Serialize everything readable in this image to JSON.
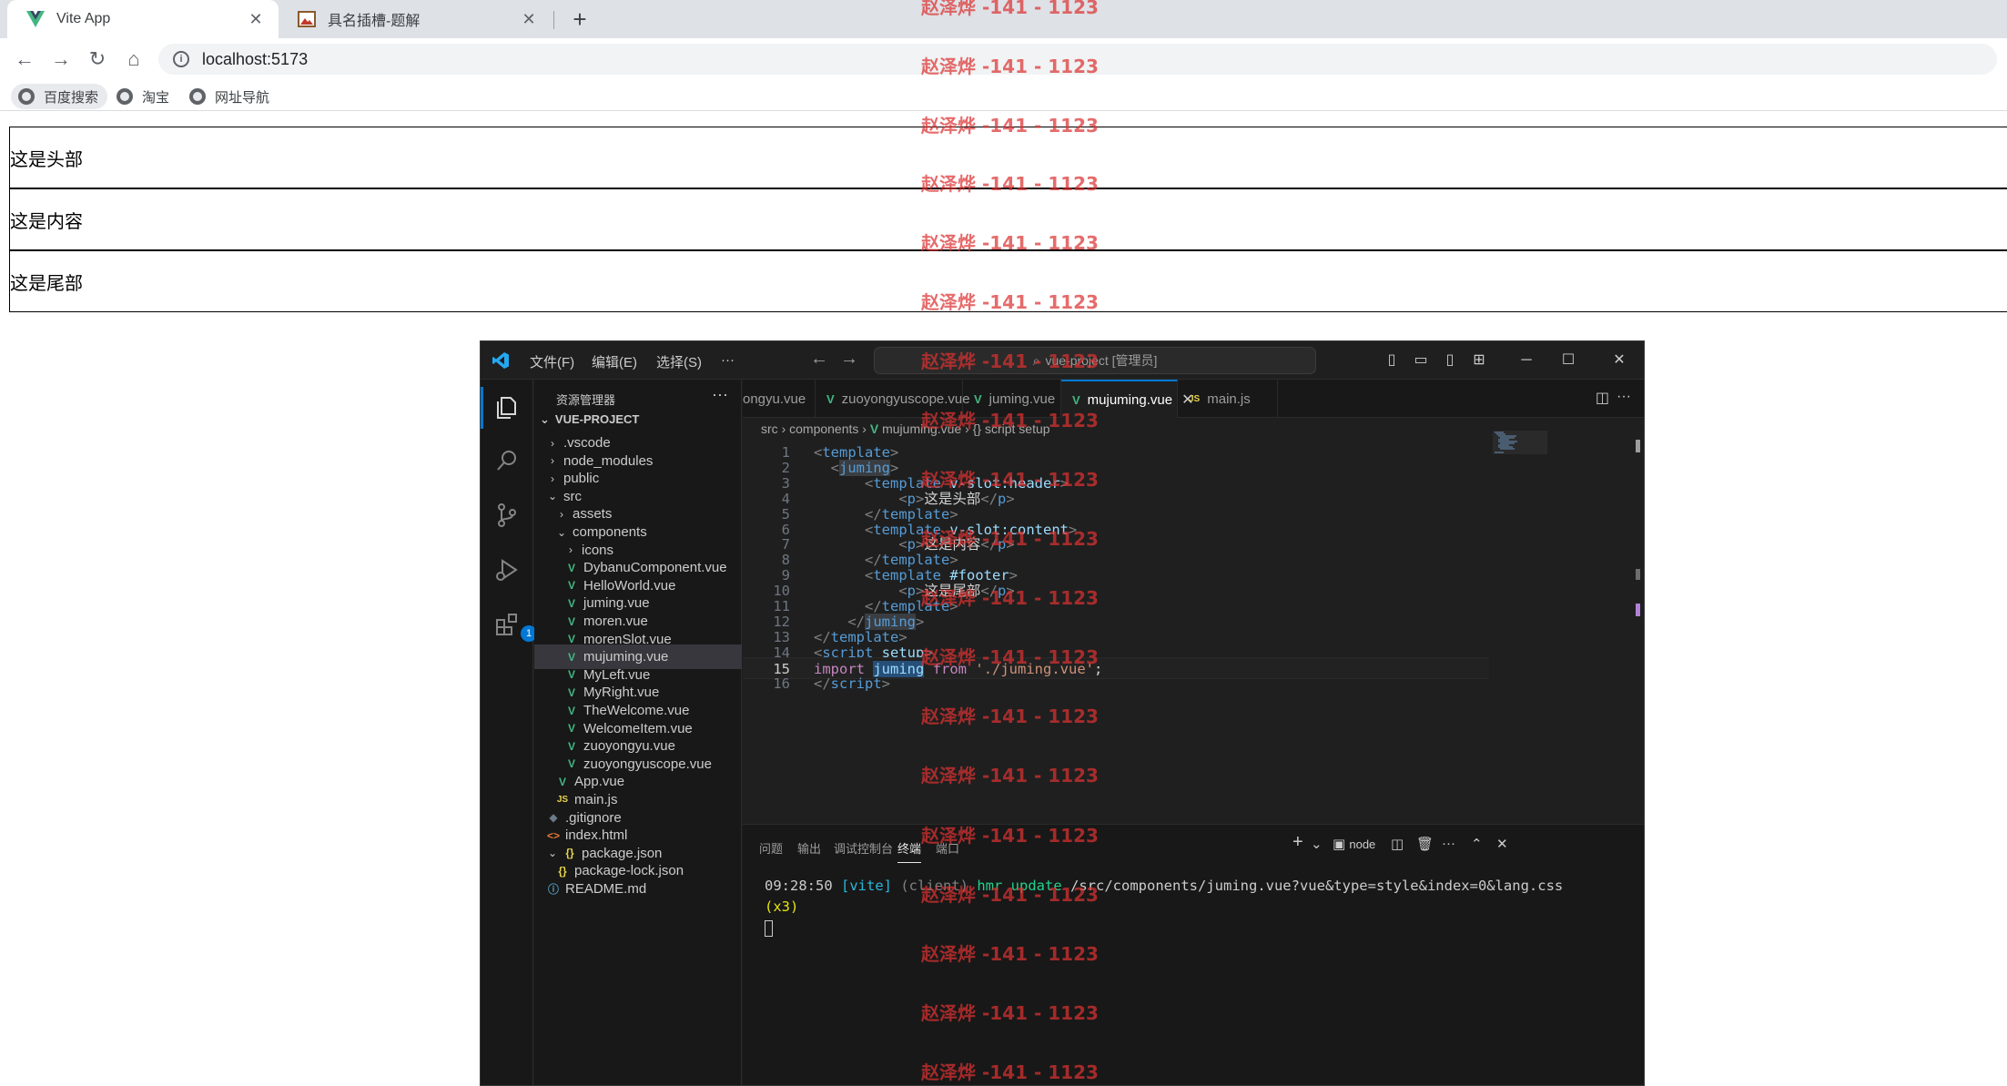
{
  "browser": {
    "tabs": [
      {
        "title": "Vite App",
        "icon": "vue-logo-icon",
        "active": true
      },
      {
        "title": "具名插槽-题解",
        "icon": "image-favicon-icon",
        "active": false
      }
    ],
    "address": "localhost:5173",
    "bookmarks": [
      "百度搜索",
      "淘宝",
      "网址导航"
    ]
  },
  "page": {
    "header_text": "这是头部",
    "content_text": "这是内容",
    "footer_text": "这是尾部"
  },
  "vscode": {
    "menu": [
      "文件(F)",
      "编辑(E)",
      "选择(S)",
      "···"
    ],
    "command_center": "vue-project [管理员]",
    "extensions_badge": "1",
    "explorer_title": "资源管理器",
    "project_name": "VUE-PROJECT",
    "tree": [
      {
        "label": ".vscode",
        "kind": "folder",
        "depth": 1,
        "open": false
      },
      {
        "label": "node_modules",
        "kind": "folder",
        "depth": 1,
        "open": false
      },
      {
        "label": "public",
        "kind": "folder",
        "depth": 1,
        "open": false
      },
      {
        "label": "src",
        "kind": "folder",
        "depth": 1,
        "open": true
      },
      {
        "label": "assets",
        "kind": "folder",
        "depth": 2,
        "open": false
      },
      {
        "label": "components",
        "kind": "folder",
        "depth": 2,
        "open": true
      },
      {
        "label": "icons",
        "kind": "folder",
        "depth": 3,
        "open": false
      },
      {
        "label": "DybanuComponent.vue",
        "kind": "vue",
        "depth": 3
      },
      {
        "label": "HelloWorld.vue",
        "kind": "vue",
        "depth": 3
      },
      {
        "label": "juming.vue",
        "kind": "vue",
        "depth": 3
      },
      {
        "label": "moren.vue",
        "kind": "vue",
        "depth": 3
      },
      {
        "label": "morenSlot.vue",
        "kind": "vue",
        "depth": 3
      },
      {
        "label": "mujuming.vue",
        "kind": "vue",
        "depth": 3,
        "selected": true
      },
      {
        "label": "MyLeft.vue",
        "kind": "vue",
        "depth": 3
      },
      {
        "label": "MyRight.vue",
        "kind": "vue",
        "depth": 3
      },
      {
        "label": "TheWelcome.vue",
        "kind": "vue",
        "depth": 3
      },
      {
        "label": "WelcomeItem.vue",
        "kind": "vue",
        "depth": 3
      },
      {
        "label": "zuoyongyu.vue",
        "kind": "vue",
        "depth": 3
      },
      {
        "label": "zuoyongyuscope.vue",
        "kind": "vue",
        "depth": 3
      },
      {
        "label": "App.vue",
        "kind": "vue",
        "depth": 2
      },
      {
        "label": "main.js",
        "kind": "js",
        "depth": 2
      },
      {
        "label": ".gitignore",
        "kind": "git",
        "depth": 1
      },
      {
        "label": "index.html",
        "kind": "html",
        "depth": 1
      },
      {
        "label": "package.json",
        "kind": "json",
        "depth": 1,
        "open": true
      },
      {
        "label": "package-lock.json",
        "kind": "json",
        "depth": 2
      },
      {
        "label": "README.md",
        "kind": "info",
        "depth": 1
      }
    ],
    "editor_tabs": [
      {
        "label": "ongyu.vue",
        "icon": "vue",
        "active": false
      },
      {
        "label": "zuoyongyuscope.vue",
        "icon": "vue",
        "active": false
      },
      {
        "label": "juming.vue",
        "icon": "vue",
        "active": false
      },
      {
        "label": "mujuming.vue",
        "icon": "vue",
        "active": true
      },
      {
        "label": "main.js",
        "icon": "js",
        "active": false
      }
    ],
    "breadcrumb": {
      "a": "src",
      "b": "components",
      "c": "mujuming.vue",
      "d": "{} script setup"
    },
    "code_lines": [
      {
        "n": "1",
        "html": "<span class=\"br\">&lt;</span><span class=\"tg\">template</span><span class=\"br\">&gt;</span>"
      },
      {
        "n": "2",
        "html": "  <span class=\"br\">&lt;</span><span class=\"tg hl1\">juming</span><span class=\"br\">&gt;</span>"
      },
      {
        "n": "3",
        "html": "      <span class=\"br\">&lt;</span><span class=\"tg\">template</span> <span class=\"at\">v-slot:header</span><span class=\"br\">&gt;</span>"
      },
      {
        "n": "4",
        "html": "          <span class=\"br\">&lt;</span><span class=\"tg\">p</span><span class=\"br\">&gt;</span>这是头部<span class=\"br\">&lt;/</span><span class=\"tg\">p</span><span class=\"br\">&gt;</span>"
      },
      {
        "n": "5",
        "html": "      <span class=\"br\">&lt;/</span><span class=\"tg\">template</span><span class=\"br\">&gt;</span>"
      },
      {
        "n": "6",
        "html": "      <span class=\"br\">&lt;</span><span class=\"tg\">template</span> <span class=\"at\">v-slot:content</span><span class=\"br\">&gt;</span>"
      },
      {
        "n": "7",
        "html": "          <span class=\"br\">&lt;</span><span class=\"tg\">p</span><span class=\"br\">&gt;</span>这是内容<span class=\"br\">&lt;/</span><span class=\"tg\">p</span><span class=\"br\">&gt;</span>"
      },
      {
        "n": "8",
        "html": "      <span class=\"br\">&lt;/</span><span class=\"tg\">template</span><span class=\"br\">&gt;</span>"
      },
      {
        "n": "9",
        "html": "      <span class=\"br\">&lt;</span><span class=\"tg\">template</span> <span class=\"at\">#footer</span><span class=\"br\">&gt;</span>"
      },
      {
        "n": "10",
        "html": "          <span class=\"br\">&lt;</span><span class=\"tg\">p</span><span class=\"br\">&gt;</span>这是尾部<span class=\"br\">&lt;/</span><span class=\"tg\">p</span><span class=\"br\">&gt;</span>"
      },
      {
        "n": "11",
        "html": "      <span class=\"br\">&lt;/</span><span class=\"tg\">template</span><span class=\"br\">&gt;</span>"
      },
      {
        "n": "12",
        "html": "    <span class=\"br\">&lt;/</span><span class=\"tg hl1\">juming</span><span class=\"br\">&gt;</span>"
      },
      {
        "n": "13",
        "html": "<span class=\"br\">&lt;/</span><span class=\"tg\">template</span><span class=\"br\">&gt;</span>"
      },
      {
        "n": "14",
        "html": "<span class=\"br\">&lt;</span><span class=\"tg\">script</span> <span class=\"at\">setup</span><span class=\"br\">&gt;</span>"
      },
      {
        "n": "15",
        "html": "<span class=\"kw\">import</span> <span class=\"id hl2\">juming</span> <span class=\"kw\">from</span> <span class=\"st\">'./juming.vue'</span><span class=\"pu\">;</span>",
        "current": true
      },
      {
        "n": "16",
        "html": "<span class=\"br\">&lt;/</span><span class=\"tg\">script</span><span class=\"br\">&gt;</span>"
      }
    ],
    "panel_tabs": [
      "问题",
      "输出",
      "调试控制台",
      "终端",
      "端口"
    ],
    "terminal_label": "node",
    "terminal": {
      "time": "09:28:50",
      "tag": "[vite]",
      "client": "(client)",
      "hmr": "hmr update",
      "path": "/src/components/juming.vue?vue&type=style&index=0&lang.css",
      "count": "(x3)"
    }
  },
  "watermark": "赵泽烨 -141 - 1123"
}
